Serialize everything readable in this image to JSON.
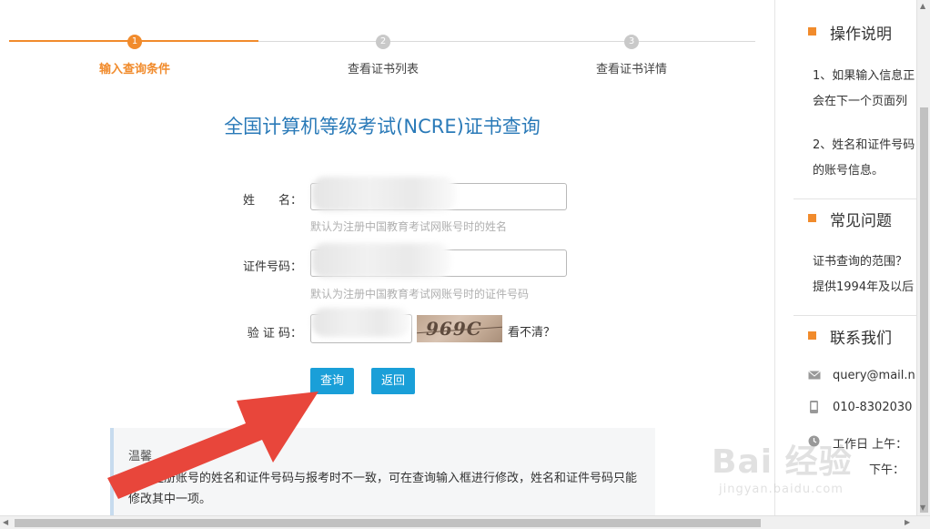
{
  "stepper": {
    "steps": [
      {
        "number": "1",
        "label": "输入查询条件",
        "state": "active"
      },
      {
        "number": "2",
        "label": "查看证书列表",
        "state": "inactive"
      },
      {
        "number": "3",
        "label": "查看证书详情",
        "state": "inactive"
      }
    ],
    "accent_color": "#f18b2c"
  },
  "main": {
    "title": "全国计算机等级考试(NCRE)证书查询",
    "form": {
      "name_label": "姓　　名：",
      "name_hint": "默认为注册中国教育考试网账号时的姓名",
      "id_label": "证件号码：",
      "id_hint": "默认为注册中国教育考试网账号时的证件号码",
      "captcha_label": "验 证 码：",
      "captcha_image_text": "969C",
      "captcha_refresh": "看不清？"
    },
    "buttons": {
      "query": "查询",
      "back": "返回"
    },
    "tip": {
      "title": "温馨",
      "text": "…您注册账号的姓名和证件号码与报考时不一致，可在查询输入框进行修改，姓名和证件号码只能修改其中一项。"
    }
  },
  "sidebar": {
    "sections": [
      {
        "title": "操作说明",
        "lines": [
          "1、如果输入信息正",
          "会在下一个页面列",
          "2、姓名和证件号码",
          "的账号信息。"
        ]
      },
      {
        "title": "常见问题",
        "lines": [
          "证书查询的范围？",
          "提供1994年及以后"
        ]
      },
      {
        "title": "联系我们",
        "contacts": [
          {
            "icon": "mail-icon",
            "text": "query@mail.n"
          },
          {
            "icon": "phone-icon",
            "text": "010-8302030"
          },
          {
            "icon": "clock-icon",
            "text": "工作日 上午："
          },
          {
            "icon": "",
            "text": "下午："
          }
        ]
      }
    ]
  },
  "watermark": {
    "logo": "Bai 经验",
    "url": "jingyan.baidu.com"
  },
  "colors": {
    "accent": "#f18b2c",
    "title_blue": "#2a7ab8",
    "button_blue": "#1a9fd8"
  }
}
